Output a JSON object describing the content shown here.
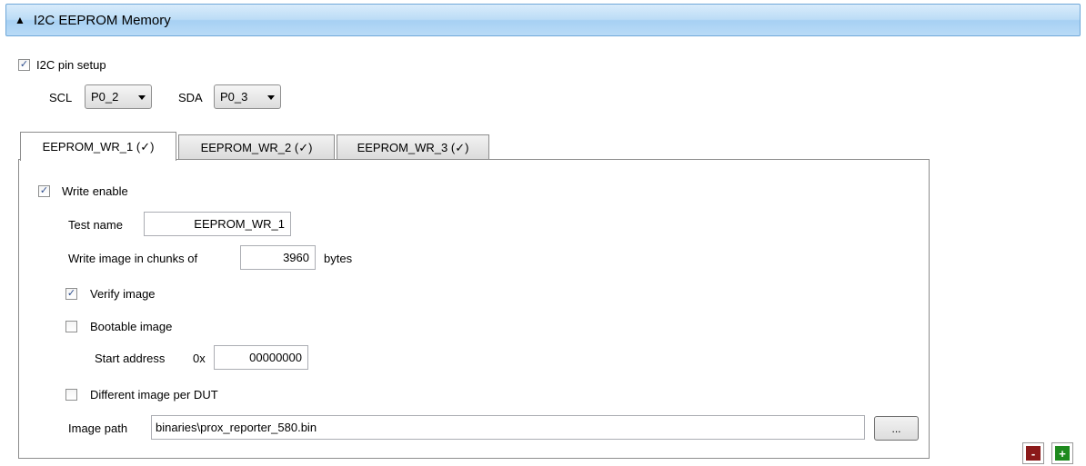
{
  "section": {
    "title": "I2C EEPROM Memory",
    "expanded_icon": "collapse-triangle-up"
  },
  "pin_setup": {
    "label": "I2C pin setup",
    "checked": true,
    "scl_label": "SCL",
    "scl_value": "P0_2",
    "sda_label": "SDA",
    "sda_value": "P0_3"
  },
  "tabs": [
    {
      "label": "EEPROM_WR_1 (✓)",
      "active": true
    },
    {
      "label": "EEPROM_WR_2 (✓)",
      "active": false
    },
    {
      "label": "EEPROM_WR_3 (✓)",
      "active": false
    }
  ],
  "form": {
    "write_enable_label": "Write enable",
    "test_name_label": "Test name",
    "test_name_value": "EEPROM_WR_1",
    "chunks_label": "Write image in chunks of",
    "chunks_value": "3960",
    "chunks_unit": "bytes",
    "verify_label": "Verify image",
    "bootable_label": "Bootable image",
    "start_address_label": "Start address",
    "start_address_prefix": "0x",
    "start_address_value": "00000000",
    "different_image_label": "Different image per DUT",
    "image_path_label": "Image path",
    "image_path_value": "binaries\\prox_reporter_580.bin",
    "browse_label": "..."
  },
  "actions": {
    "remove_symbol": "-",
    "add_symbol": "+",
    "remove_color": "#8b1a1a",
    "add_color": "#1e8a1e"
  }
}
